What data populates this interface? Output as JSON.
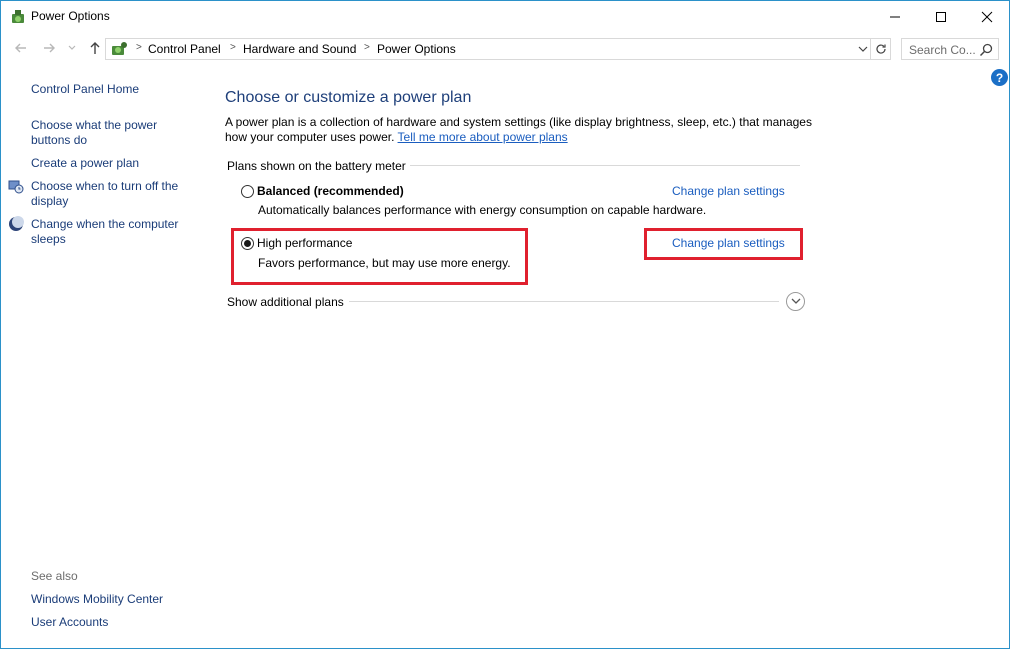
{
  "window": {
    "title": "Power Options"
  },
  "address": {
    "breadcrumbs": [
      "Control Panel",
      "Hardware and Sound",
      "Power Options"
    ],
    "search_placeholder": "Search Co..."
  },
  "left_pane": {
    "home": "Control Panel Home",
    "links": [
      "Choose what the power buttons do",
      "Create a power plan",
      "Choose when to turn off the display",
      "Change when the computer sleeps"
    ],
    "see_also_label": "See also",
    "see_also": [
      "Windows Mobility Center",
      "User Accounts"
    ]
  },
  "main": {
    "heading": "Choose or customize a power plan",
    "description": "A power plan is a collection of hardware and system settings (like display brightness, sleep, etc.) that manages how your computer uses power.",
    "description_link": "Tell me more about power plans",
    "group_label": "Plans shown on the battery meter",
    "plans": [
      {
        "name": "Balanced (recommended)",
        "description": "Automatically balances performance with energy consumption on capable hardware.",
        "link": "Change plan settings",
        "selected": false
      },
      {
        "name": "High performance",
        "description": "Favors performance, but may use more energy.",
        "link": "Change plan settings",
        "selected": true
      }
    ],
    "show_more": "Show additional plans"
  },
  "colors": {
    "highlight": "#e0202e",
    "link": "#1a5dbf",
    "heading": "#1e3f7a"
  }
}
